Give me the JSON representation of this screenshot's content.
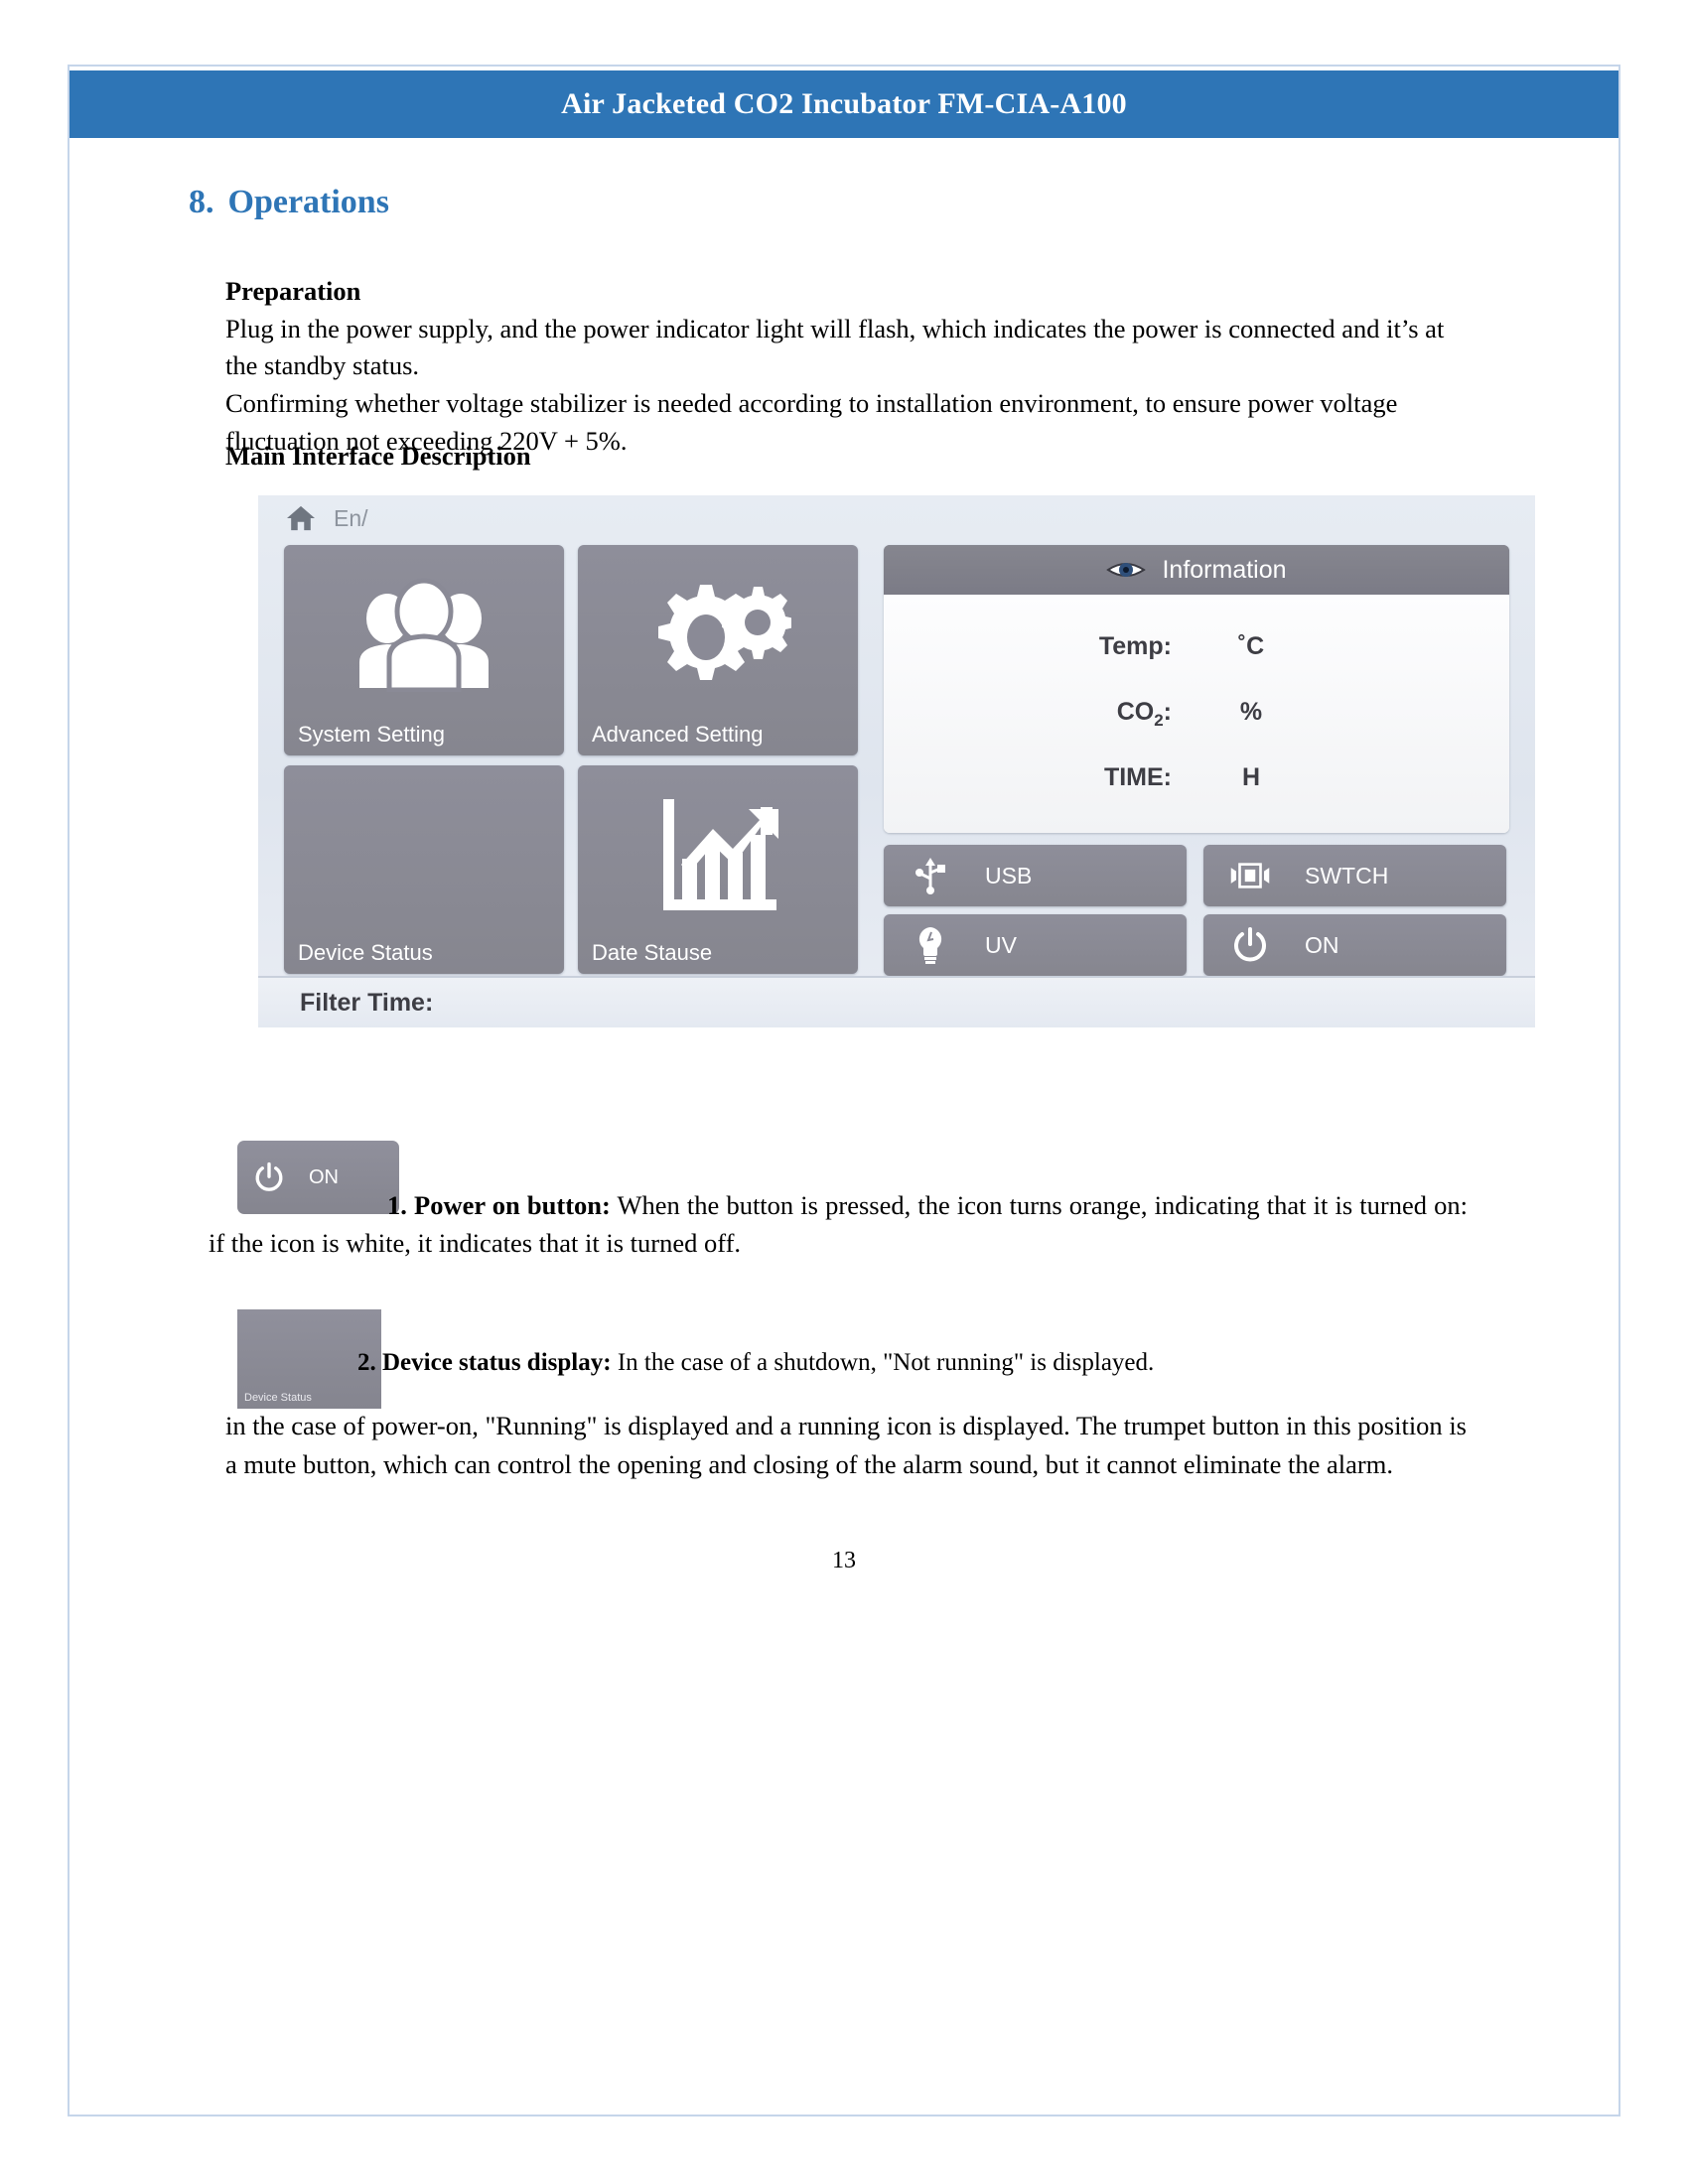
{
  "document": {
    "header_title": "Air Jacketed CO2 Incubator FM-CIA-A100",
    "page_number": "13",
    "header_color": "#2e75b6",
    "border_color": "#c5d5ea"
  },
  "section": {
    "number": "8.",
    "title": "Operations"
  },
  "preparation": {
    "heading": "Preparation",
    "line1": "Plug in the power supply, and the power indicator light will flash, which indicates the power is connected and it’s at the standby status.",
    "line2": "Confirming whether voltage stabilizer is needed according to installation environment, to ensure power voltage fluctuation not exceeding 220V + 5%."
  },
  "main_interface": {
    "heading": "Main Interface Description"
  },
  "device_ui": {
    "topbar": {
      "home_icon": "home-icon",
      "language": "En/"
    },
    "tiles": [
      {
        "label": "System Setting",
        "icon": "users-group-icon"
      },
      {
        "label": "Advanced Setting",
        "icon": "gears-icon"
      },
      {
        "label": "Device Status",
        "icon": "none"
      },
      {
        "label": "Date Stause",
        "icon": "bar-chart-arrow-icon"
      }
    ],
    "information": {
      "title": "Information",
      "icon": "eye-icon",
      "rows": [
        {
          "label": "Temp:",
          "value": "",
          "unit": "˚C"
        },
        {
          "label": "CO",
          "sub": "2",
          "label_tail": ":",
          "value": "",
          "unit": "%"
        },
        {
          "label": "TIME:",
          "value": "",
          "unit": "H"
        }
      ]
    },
    "buttons": [
      {
        "label": "USB",
        "icon": "usb-icon"
      },
      {
        "label": "SWTCH",
        "icon": "switch-icon"
      },
      {
        "label": "UV",
        "icon": "bulb-icon"
      },
      {
        "label": "ON",
        "icon": "power-icon"
      }
    ],
    "filter_time_label": "Filter Time:",
    "tile_color": "#8a8a96",
    "panel_bg_color": "#e3e8f0"
  },
  "callout1": {
    "thumbnail_label": "ON",
    "thumbnail_icon": "power-icon",
    "title": "1. Power on button:",
    "body": "When the button is pressed, the icon turns orange, indicating that it is turned on: if the icon is white, it indicates that it is turned off."
  },
  "callout2": {
    "thumbnail_label": "Device Status",
    "title": "2. Device status display:",
    "body": "In the case of a shutdown, \"Not running\" is displayed.",
    "paragraph": "in the case of power-on, \"Running\" is displayed and a running icon is displayed. The trumpet button in this position is a mute button, which can control the opening and closing of the alarm sound, but it cannot eliminate the alarm."
  }
}
